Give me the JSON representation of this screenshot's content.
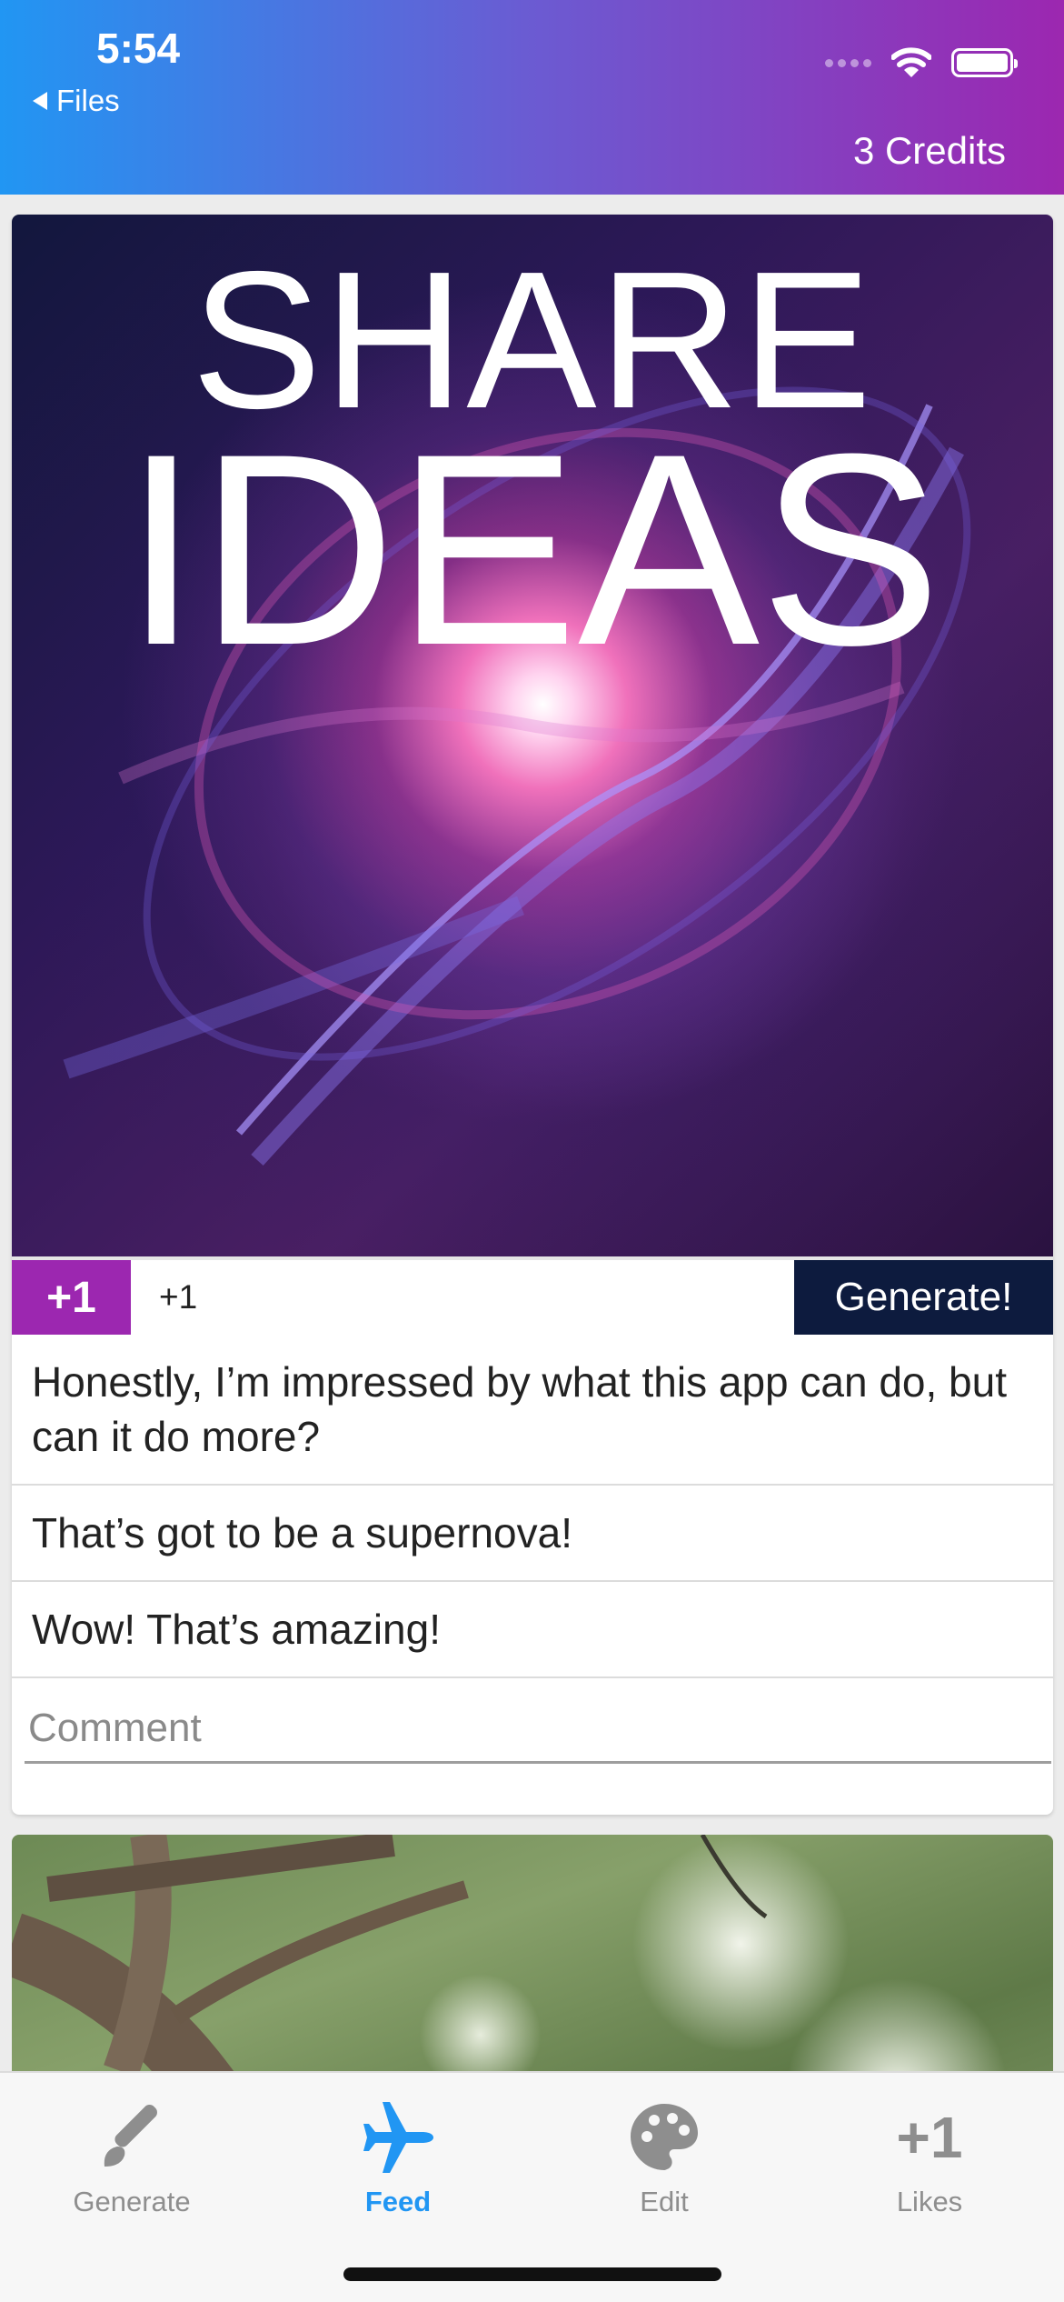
{
  "status_bar": {
    "time": "5:54",
    "back_label": "Files"
  },
  "header": {
    "credits": "3 Credits"
  },
  "post": {
    "image_text_line1": "SHARE",
    "image_text_line2": "IDEAS",
    "plus_button": "+1",
    "like_count": "+1",
    "generate_button": "Generate!",
    "comments": [
      "Honestly, I’m impressed by what this app can do, but can it do more?",
      "That’s got to be a supernova!",
      "Wow! That’s amazing!"
    ],
    "comment_placeholder": "Comment"
  },
  "tabs": [
    {
      "label": "Generate",
      "icon": "paintbrush-icon",
      "active": false
    },
    {
      "label": "Feed",
      "icon": "airplane-icon",
      "active": true
    },
    {
      "label": "Edit",
      "icon": "palette-icon",
      "active": false
    },
    {
      "label": "Likes",
      "icon": "plus-one-icon",
      "glyph": "+1",
      "active": false
    }
  ],
  "colors": {
    "active_tab": "#2196f3",
    "inactive_tab": "#8e8e8e",
    "plus_button": "#9c27b0",
    "generate_button": "#0d1b3e"
  }
}
